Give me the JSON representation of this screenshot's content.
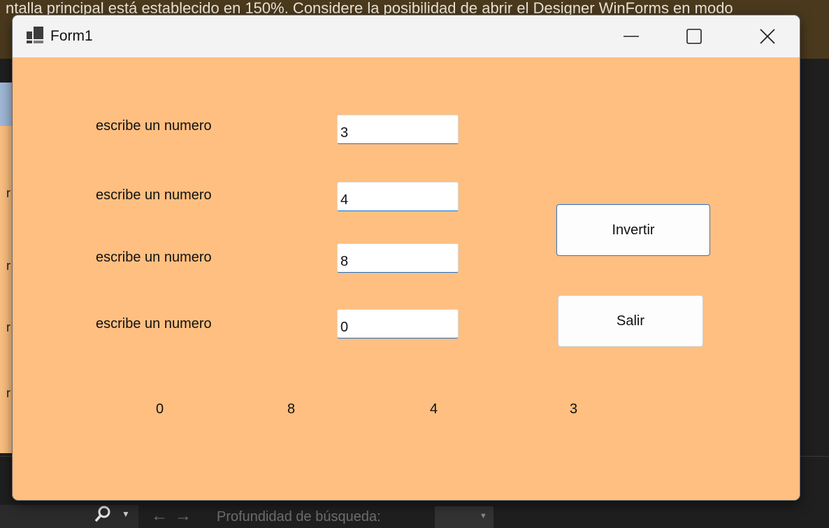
{
  "background": {
    "banner_text": "ntalla principal está establecido en 150%. Considere la posibilidad de abrir el Designer WinForms en modo",
    "left_glyphs": [
      "r",
      "r",
      "r",
      "r"
    ],
    "bottom_bar": {
      "depth_label": "Profundidad de búsqueda:"
    }
  },
  "window": {
    "title": "Form1",
    "minimize_glyph": "—",
    "inputs": [
      {
        "label": "escribe un numero",
        "value": "3"
      },
      {
        "label": "escribe un numero",
        "value": "4"
      },
      {
        "label": "escribe un numero",
        "value": "8"
      },
      {
        "label": "escribe un numero",
        "value": "0"
      }
    ],
    "buttons": {
      "invertir": "Invertir",
      "salir": "Salir"
    },
    "outputs": [
      "0",
      "8",
      "4",
      "3"
    ]
  },
  "colors": {
    "form_background": "#ffbf80",
    "titlebar": "#f3f3f3",
    "focus_border": "#2b76c7"
  }
}
